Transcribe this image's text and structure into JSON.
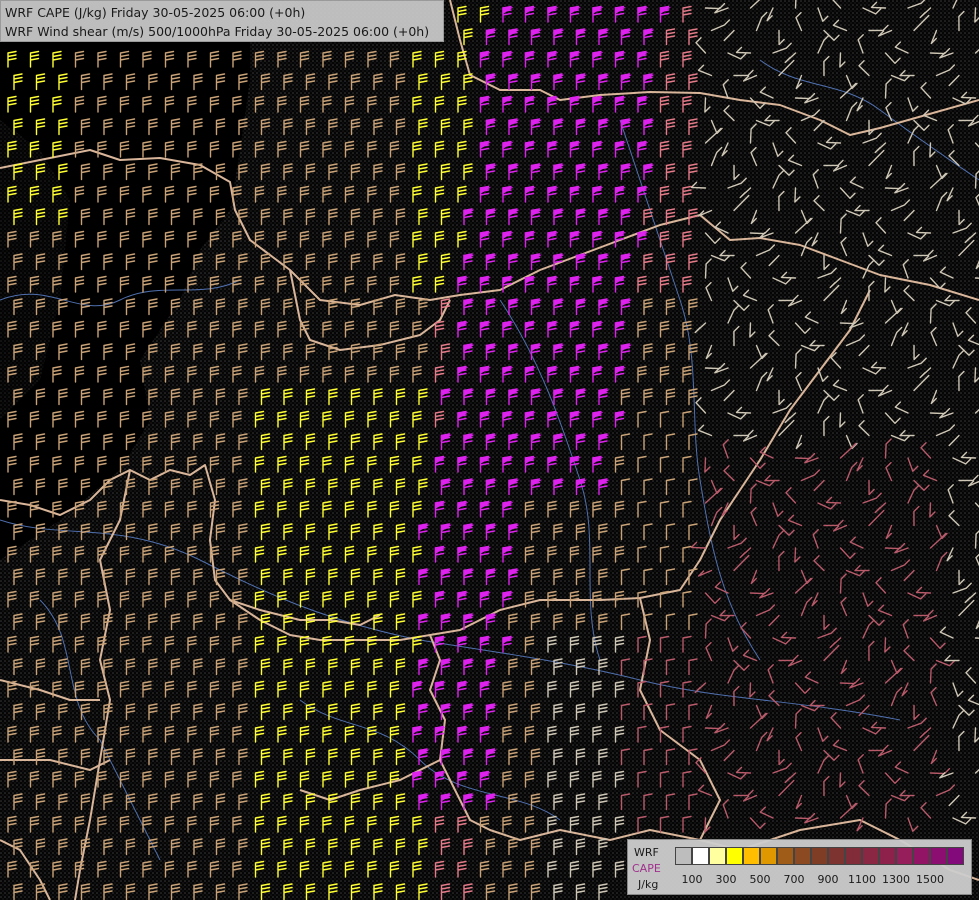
{
  "header": {
    "line1": "WRF CAPE (J/kg) Friday 30-05-2025 06:00 (+0h)",
    "line2": "WRF Wind shear (m/s) 500/1000hPa Friday 30-05-2025 06:00 (+0h)"
  },
  "legend": {
    "model": "WRF",
    "variable": "CAPE",
    "unit": "J/kg",
    "colors": [
      "#bdbdbd",
      "#ffffff",
      "#ffff9f",
      "#ffff00",
      "#ffbf00",
      "#df9800",
      "#9f5c19",
      "#8c4a22",
      "#803d26",
      "#7d332f",
      "#822c3a",
      "#8a2742",
      "#8e214c",
      "#961e5b",
      "#911564",
      "#8b0e70",
      "#830a7b"
    ],
    "tick_labels": [
      "100",
      "300",
      "500",
      "700",
      "900",
      "1100",
      "1300",
      "1500"
    ]
  },
  "map_colors": {
    "background": "#000000",
    "terrain_dots": "#3c3c3c",
    "borders": "#e0b79a",
    "rivers": "#4f6fae",
    "barb_low": "#cfc7b6",
    "barb_tan": "#c9a277",
    "barb_yellow": "#ffff33",
    "barb_pink": "#e57a89",
    "barb_rose": "#b85a6a",
    "barb_magenta": "#dd22ee"
  }
}
